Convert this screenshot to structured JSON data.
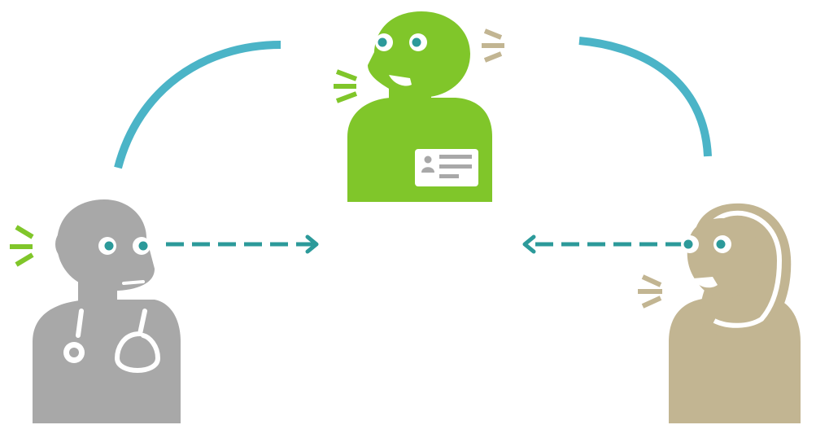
{
  "diagram": {
    "participants": [
      {
        "role": "doctor",
        "icon": "doctor-icon",
        "color": "#a8a8a8",
        "position": "bottom-left"
      },
      {
        "role": "interpreter",
        "icon": "interpreter-icon",
        "color": "#80c62a",
        "position": "top-center"
      },
      {
        "role": "patient",
        "icon": "patient-icon",
        "color": "#c2b592",
        "position": "bottom-right"
      }
    ],
    "connections": [
      {
        "type": "arc",
        "from": "doctor",
        "to": "interpreter",
        "color": "#4bb4c7"
      },
      {
        "type": "arc",
        "from": "interpreter",
        "to": "patient",
        "color": "#4bb4c7"
      },
      {
        "type": "dashed-arrow",
        "from": "doctor",
        "direction": "right",
        "color": "#2c9a9a"
      },
      {
        "type": "dashed-arrow",
        "from": "patient",
        "direction": "left",
        "color": "#2c9a9a"
      }
    ],
    "sound_marks": [
      {
        "near": "doctor",
        "color": "#80c62a"
      },
      {
        "near": "interpreter",
        "side": "left",
        "color": "#80c62a"
      },
      {
        "near": "interpreter",
        "side": "right",
        "color": "#c2b592"
      },
      {
        "near": "patient",
        "color": "#c2b592"
      }
    ],
    "eye_color": "#2c9a9a",
    "badge_color": "#ffffff"
  }
}
